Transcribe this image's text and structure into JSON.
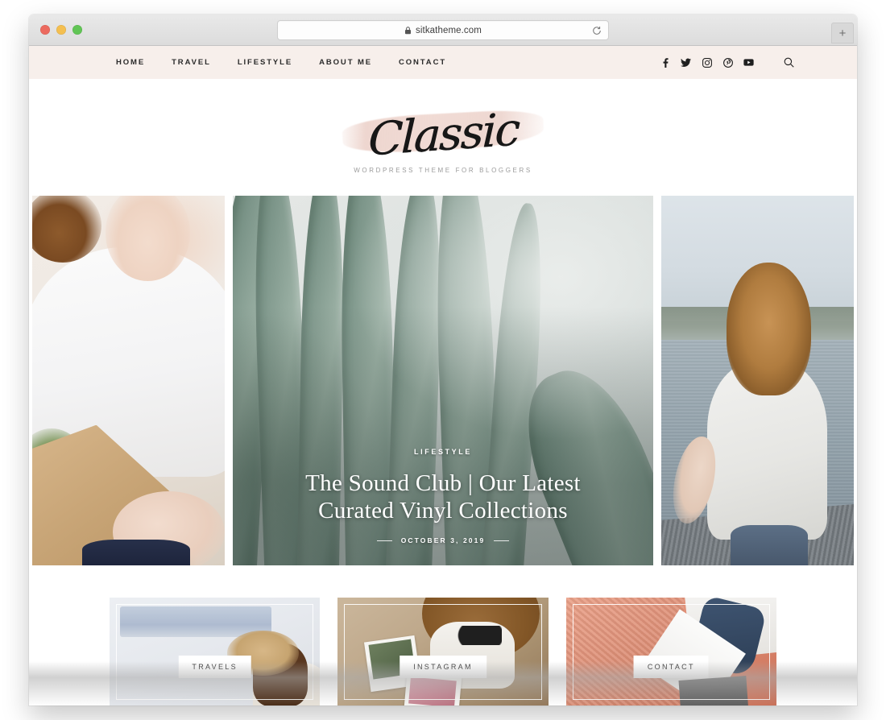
{
  "browser": {
    "url": "sitkatheme.com",
    "lock_icon": "lock-icon",
    "reload_icon": "reload-icon",
    "new_tab_label": "+",
    "traffic_lights": [
      "close",
      "minimize",
      "zoom"
    ]
  },
  "nav": {
    "items": [
      {
        "label": "HOME"
      },
      {
        "label": "TRAVEL"
      },
      {
        "label": "LIFESTYLE"
      },
      {
        "label": "ABOUT ME"
      },
      {
        "label": "CONTACT"
      }
    ],
    "social": [
      {
        "name": "facebook-icon",
        "glyph": "f"
      },
      {
        "name": "twitter-icon",
        "glyph": "t"
      },
      {
        "name": "instagram-icon",
        "glyph": "i"
      },
      {
        "name": "pinterest-icon",
        "glyph": "p"
      },
      {
        "name": "youtube-icon",
        "glyph": "y"
      }
    ],
    "search_icon": "search-icon",
    "background_color": "#f7efeb"
  },
  "logo": {
    "wordmark": "Classic",
    "tagline": "WORDPRESS THEME FOR BLOGGERS",
    "brush_color": "#eed6ce"
  },
  "hero": {
    "left_image_alt": "woman in white sweater holding bouquet wrapped in kraft paper",
    "right_image_alt": "woman from behind walking on a dock by the water",
    "featured": {
      "image_alt": "close-up of agave plant leaves",
      "category": "LIFESTYLE",
      "title": "The Sound Club | Our Latest Curated Vinyl Collections",
      "title_line1": "The Sound Club | Our Latest",
      "title_line2": "Curated Vinyl Collections",
      "date": "OCTOBER 3, 2019"
    }
  },
  "cards": [
    {
      "label": "TRAVELS",
      "image_alt": "woman with straw hat by white wall"
    },
    {
      "label": "INSTAGRAM",
      "image_alt": "flatlay with polaroids, sunglasses and hat"
    },
    {
      "label": "CONTACT",
      "image_alt": "person in jeans on coral blanket with laptop"
    }
  ]
}
